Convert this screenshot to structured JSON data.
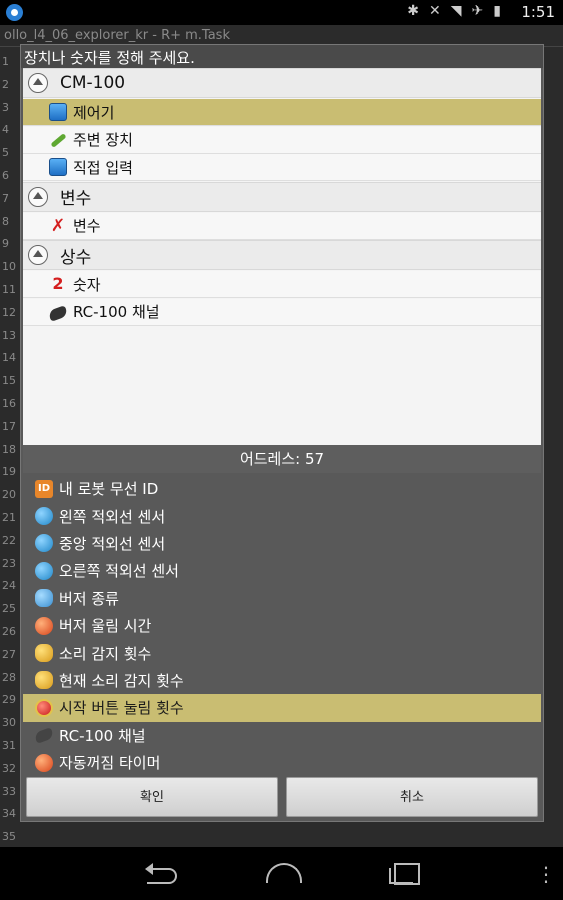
{
  "status_bar": {
    "time": "1:51"
  },
  "background_app": {
    "title": "ollo_l4_06_explorer_kr - R+ m.Task",
    "line_numbers": [
      "1",
      "2",
      "3",
      "4",
      "5",
      "6",
      "7",
      "8",
      "9",
      "10",
      "11",
      "12",
      "13",
      "14",
      "15",
      "16",
      "17",
      "18",
      "19",
      "20",
      "21",
      "22",
      "23",
      "24",
      "25",
      "26",
      "27",
      "28",
      "29",
      "30",
      "31",
      "32",
      "33",
      "34",
      "35"
    ]
  },
  "dialog": {
    "title": "장치나 숫자를 정해 주세요.",
    "tree": [
      {
        "type": "group",
        "label": "CM-100"
      },
      {
        "type": "item",
        "label": "제어기",
        "icon": "monitor-icon",
        "selected": true
      },
      {
        "type": "item",
        "label": "주변 장치",
        "icon": "cable-icon",
        "selected": false
      },
      {
        "type": "item",
        "label": "직접 입력",
        "icon": "monitor-icon",
        "selected": false
      },
      {
        "type": "group",
        "label": "변수"
      },
      {
        "type": "item",
        "label": "변수",
        "icon": "x-icon",
        "selected": false
      },
      {
        "type": "group",
        "label": "상수"
      },
      {
        "type": "item",
        "label": "숫자",
        "icon": "number-two-icon",
        "selected": false
      },
      {
        "type": "item",
        "label": "RC-100 채널",
        "icon": "remote-icon",
        "selected": false
      }
    ],
    "address_header": "어드레스: 57",
    "params": [
      {
        "label": "내 로봇 무선 ID",
        "icon": "id-icon",
        "selected": false
      },
      {
        "label": "왼쪽 적외선 센서",
        "icon": "ir-sensor-icon",
        "selected": false
      },
      {
        "label": "중앙 적외선 센서",
        "icon": "ir-sensor-icon",
        "selected": false
      },
      {
        "label": "오른쪽 적외선 센서",
        "icon": "ir-sensor-icon",
        "selected": false
      },
      {
        "label": "버저 종류",
        "icon": "music-note-icon",
        "selected": false
      },
      {
        "label": "버저 울림 시간",
        "icon": "timer-icon",
        "selected": false
      },
      {
        "label": "소리 감지 횟수",
        "icon": "sound-icon",
        "selected": false
      },
      {
        "label": "현재 소리 감지 횟수",
        "icon": "sound-icon",
        "selected": false
      },
      {
        "label": "시작 버튼 눌림 횟수",
        "icon": "start-button-icon",
        "selected": true
      },
      {
        "label": "RC-100 채널",
        "icon": "remote-icon",
        "selected": false
      },
      {
        "label": "자동꺼짐 타이머",
        "icon": "timer-icon",
        "selected": false
      }
    ],
    "ok_label": "확인",
    "cancel_label": "취소"
  }
}
